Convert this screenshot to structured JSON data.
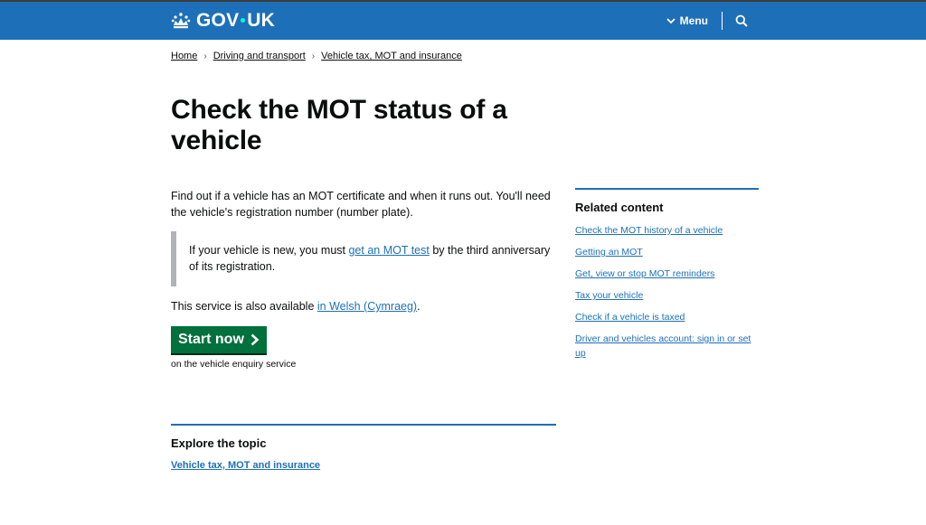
{
  "header": {
    "logo_text_left": "GOV",
    "logo_text_right": "UK",
    "menu_label": "Menu",
    "brand_color": "#1d70b8",
    "icons": [
      "crown-icon",
      "chevron-down-icon",
      "search-icon"
    ]
  },
  "breadcrumbs": [
    {
      "label": "Home"
    },
    {
      "label": "Driving and transport"
    },
    {
      "label": "Vehicle tax, MOT and insurance"
    }
  ],
  "main": {
    "title": "Check the MOT status of a vehicle",
    "lede": "Find out if a vehicle has an MOT certificate and when it runs out. You'll need the vehicle's registration number (number plate).",
    "inset": {
      "before": "If your vehicle is new, you must ",
      "link": "get an MOT test",
      "after": " by the third anniversary of its registration."
    },
    "welsh": {
      "before": "This service is also available ",
      "link": "in Welsh (Cymraeg)",
      "after": "."
    },
    "start_button": "Start now",
    "start_hint": "on the vehicle enquiry service",
    "start_button_color": "#00703c"
  },
  "explore": {
    "heading": "Explore the topic",
    "link": "Vehicle tax, MOT and insurance"
  },
  "related": {
    "heading": "Related content",
    "links": [
      "Check the MOT history of a vehicle",
      "Getting an MOT",
      "Get, view or stop MOT reminders",
      "Tax your vehicle",
      "Check if a vehicle is taxed",
      "Driver and vehicles account: sign in or set up"
    ]
  }
}
